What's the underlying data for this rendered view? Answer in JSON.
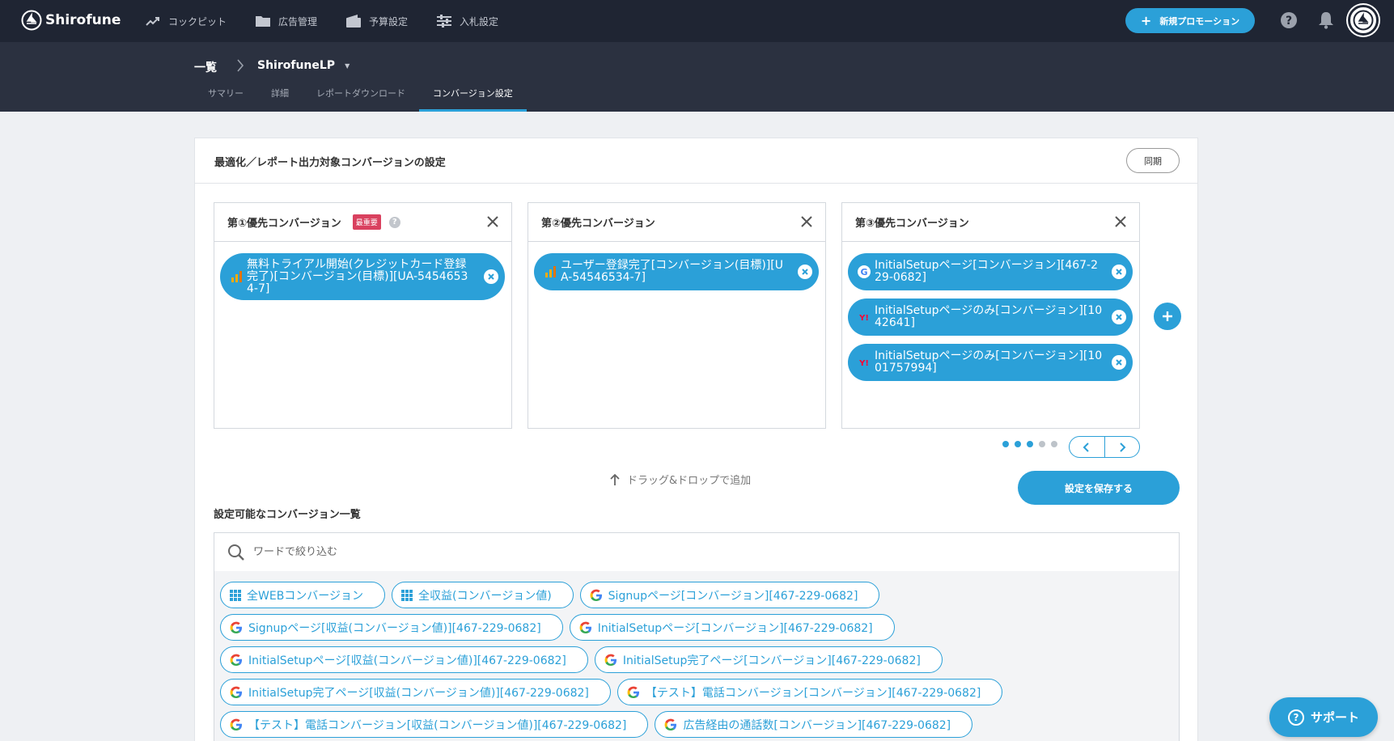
{
  "app": {
    "name": "Shirofune"
  },
  "nav": {
    "items": [
      {
        "label": "コックピット",
        "icon": "trending-up-icon"
      },
      {
        "label": "広告管理",
        "icon": "folder-icon"
      },
      {
        "label": "予算設定",
        "icon": "wallet-icon"
      },
      {
        "label": "入札設定",
        "icon": "sliders-icon"
      }
    ],
    "new_promotion": "新規プロモーション"
  },
  "breadcrumb": {
    "root": "一覧",
    "current": "ShirofuneLP"
  },
  "tabs": [
    {
      "label": "サマリー",
      "active": false
    },
    {
      "label": "詳細",
      "active": false
    },
    {
      "label": "レポートダウンロード",
      "active": false
    },
    {
      "label": "コンバージョン設定",
      "active": true
    }
  ],
  "settings": {
    "title": "最適化／レポート出力対象コンバージョンの設定",
    "sync_label": "同期",
    "slots": [
      {
        "title": "第①優先コンバージョン",
        "badge": "最重要",
        "items": [
          {
            "source": "analytics",
            "lines": [
              "無料トライアル開始(クレジットカード登録",
              "完了)[コンバージョン(目標)][UA-5454653",
              "4-7]"
            ]
          }
        ]
      },
      {
        "title": "第②優先コンバージョン",
        "items": [
          {
            "source": "analytics",
            "lines": [
              "ユーザー登録完了[コンバージョン(目標)][U",
              "A-54546534-7]"
            ]
          }
        ]
      },
      {
        "title": "第③優先コンバージョン",
        "items": [
          {
            "source": "google",
            "lines": [
              "InitialSetupページ[コンバージョン][467-2",
              "29-0682]"
            ]
          },
          {
            "source": "yahoo",
            "lines": [
              "InitialSetupページのみ[コンバージョン][10",
              "42641]"
            ]
          },
          {
            "source": "yahoo",
            "lines": [
              "InitialSetupページのみ[コンバージョン][10",
              "01757994]"
            ]
          }
        ]
      }
    ],
    "pagination": {
      "pages": 5,
      "active_pages": 3
    },
    "drag_hint": "ドラッグ&ドロップで追加",
    "save_label": "設定を保存する"
  },
  "available": {
    "title": "設定可能なコンバージョン一覧",
    "search_placeholder": "ワードで絞り込む",
    "rows": [
      [
        {
          "source": "grid",
          "label": "全WEBコンバージョン"
        },
        {
          "source": "grid",
          "label": "全収益(コンバージョン値)"
        },
        {
          "source": "google",
          "label": "Signupページ[コンバージョン][467-229-0682]"
        }
      ],
      [
        {
          "source": "google",
          "label": "Signupページ[収益(コンバージョン値)][467-229-0682]"
        },
        {
          "source": "google",
          "label": "InitialSetupページ[コンバージョン][467-229-0682]"
        }
      ],
      [
        {
          "source": "google",
          "label": "InitialSetupページ[収益(コンバージョン値)][467-229-0682]"
        },
        {
          "source": "google",
          "label": "InitialSetup完了ページ[コンバージョン][467-229-0682]"
        }
      ],
      [
        {
          "source": "google",
          "label": "InitialSetup完了ページ[収益(コンバージョン値)][467-229-0682]"
        },
        {
          "source": "google",
          "label": "【テスト】電話コンバージョン[コンバージョン][467-229-0682]"
        }
      ],
      [
        {
          "source": "google",
          "label": "【テスト】電話コンバージョン[収益(コンバージョン値)][467-229-0682]"
        },
        {
          "source": "google",
          "label": "広告経由の通話数[コンバージョン][467-229-0682]"
        }
      ]
    ]
  },
  "support_label": "サポート",
  "colors": {
    "accent": "#2ba0d8",
    "nav_bg": "#1f2533",
    "subnav_bg": "#2b3140",
    "badge": "#d9415f"
  }
}
